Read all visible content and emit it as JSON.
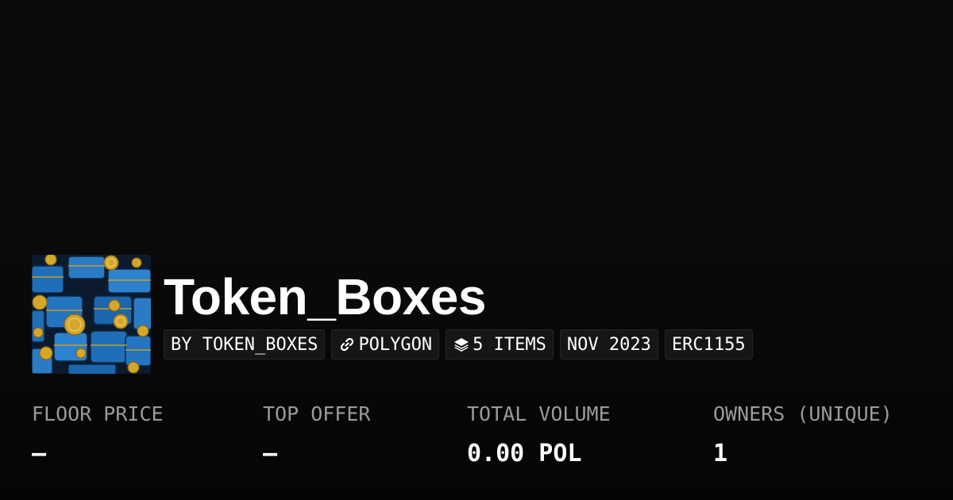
{
  "collection": {
    "title": "Token_Boxes",
    "thumbnail_icon": "treasure-chest-coins-image"
  },
  "tags": [
    {
      "label": "BY TOKEN_BOXES",
      "icon": ""
    },
    {
      "label": "POLYGON",
      "icon": "link-icon"
    },
    {
      "label": "5 ITEMS",
      "icon": "layers-icon"
    },
    {
      "label": "NOV 2023",
      "icon": ""
    },
    {
      "label": "ERC1155",
      "icon": ""
    }
  ],
  "stats": [
    {
      "label": "FLOOR PRICE",
      "value": "–"
    },
    {
      "label": "TOP OFFER",
      "value": "–"
    },
    {
      "label": "TOTAL VOLUME",
      "value": "0.00 POL"
    },
    {
      "label": "OWNERS (UNIQUE)",
      "value": "1"
    }
  ],
  "colors": {
    "background": "#0a0a0a",
    "text": "#ffffff",
    "muted": "#9a9a9a",
    "tag_bg": "#161616",
    "chest_blue": "#1f6fb8",
    "coin_gold": "#d4a72c"
  }
}
